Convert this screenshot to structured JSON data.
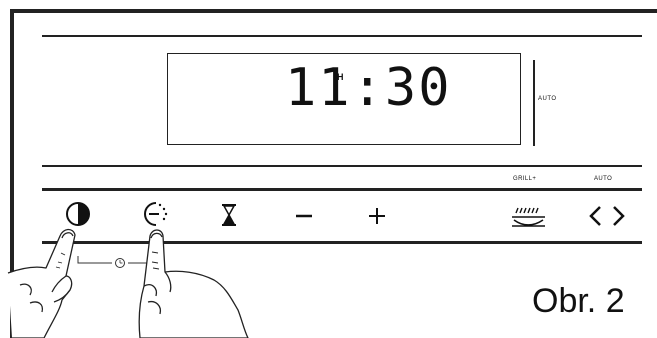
{
  "display": {
    "time": "11:30",
    "time_hour_marker": "H",
    "auto_indicator": "AUTO"
  },
  "labels": {
    "grill_plus": "GRILL+",
    "auto": "AUTO"
  },
  "buttons": [
    {
      "name": "clock-button",
      "icon": "clock-filled-quarter-icon"
    },
    {
      "name": "cook-time-button",
      "icon": "clock-dotted-end-icon"
    },
    {
      "name": "timer-button",
      "icon": "hourglass-icon"
    },
    {
      "name": "minus-button",
      "icon": "minus-icon",
      "symbol": "−"
    },
    {
      "name": "plus-button",
      "icon": "plus-icon",
      "symbol": "+"
    },
    {
      "name": "grill-button",
      "icon": "grill-icon"
    },
    {
      "name": "auto-select-button",
      "icon": "left-right-arrows-icon"
    }
  ],
  "figure_caption": "Obr. 2"
}
